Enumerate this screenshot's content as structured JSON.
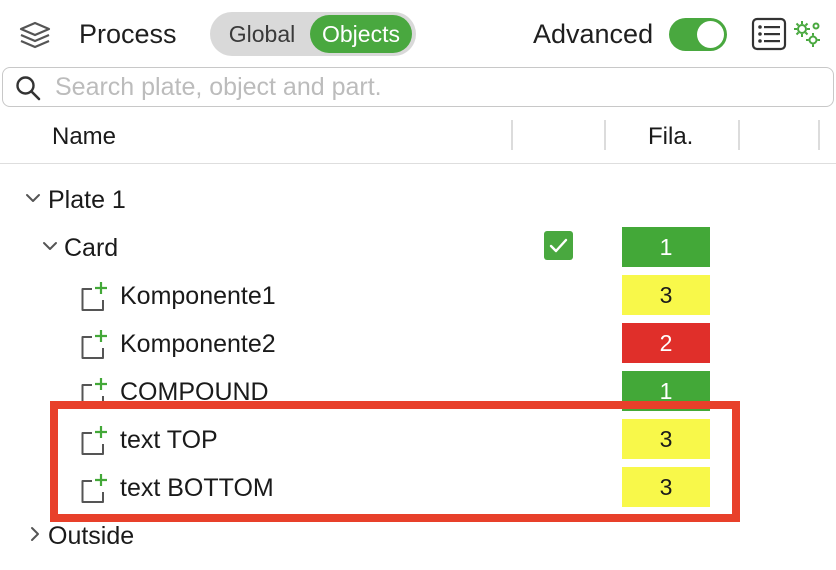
{
  "header": {
    "title": "Process",
    "segments": [
      "Global",
      "Objects"
    ],
    "selected_segment": "Objects",
    "advanced_label": "Advanced",
    "advanced_on": true,
    "icons": [
      "layers-icon",
      "list-icon",
      "settings-icon"
    ]
  },
  "search": {
    "placeholder": "Search plate, object and part.",
    "value": ""
  },
  "table": {
    "columns": [
      "Name",
      "",
      "Fila.",
      ""
    ]
  },
  "tree": {
    "plate": {
      "label": "Plate 1",
      "expanded": true
    },
    "object": {
      "label": "Card",
      "expanded": true,
      "checked": true,
      "filament": "1"
    },
    "parts": [
      {
        "label": "Komponente1",
        "filament": "3",
        "filament_color": "#f8f84a"
      },
      {
        "label": "Komponente2",
        "filament": "2",
        "filament_color": "#e02f2a"
      },
      {
        "label": "COMPOUND",
        "filament": "1",
        "filament_color": "#43a838"
      },
      {
        "label": "text TOP",
        "filament": "3",
        "filament_color": "#f8f84a"
      },
      {
        "label": "text BOTTOM",
        "filament": "3",
        "filament_color": "#f8f84a"
      }
    ],
    "outside": {
      "label": "Outside",
      "expanded": false
    }
  },
  "colors": {
    "accent": "#49a83f",
    "highlight": "#e8402a"
  }
}
